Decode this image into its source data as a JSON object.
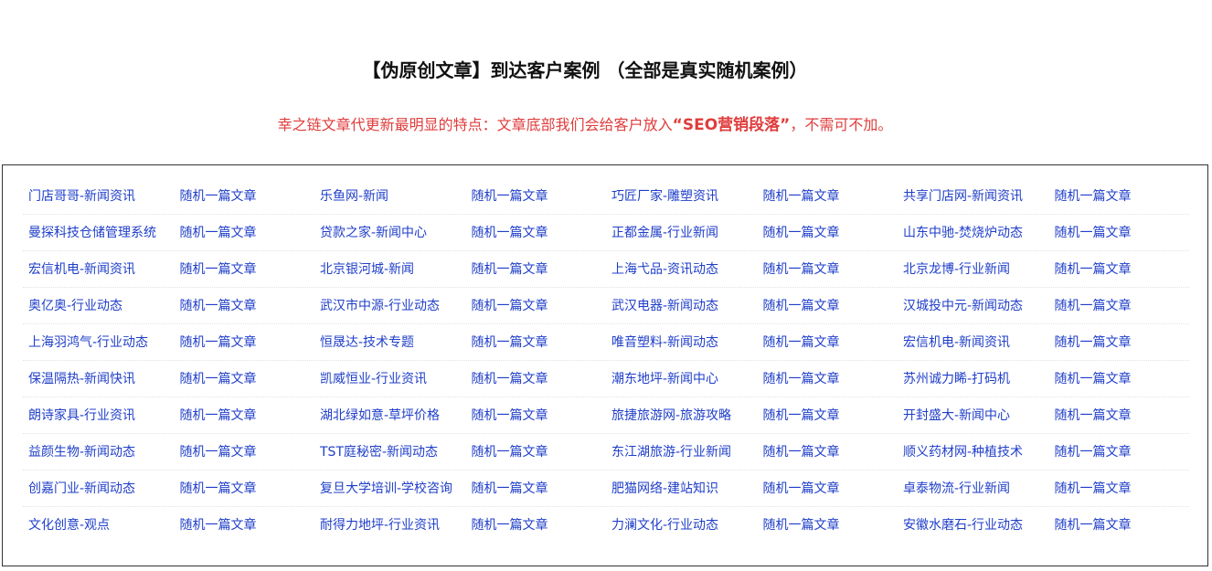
{
  "header": {
    "title": "【伪原创文章】到达客户案例 （全部是真实随机案例）",
    "subtitle_prefix": "幸之链文章代更新最明显的特点：文章底部我们会给客户放入",
    "subtitle_emphasis": "“SEO营销段落”",
    "subtitle_suffix": "，不需可不加。"
  },
  "colors": {
    "link": "#1f3ec9",
    "accent": "#e03c3c",
    "title": "#111111"
  },
  "random_label": "随机一篇文章",
  "rows": [
    [
      "门店哥哥-新闻资讯",
      "乐鱼网-新闻",
      "巧匠厂家-雕塑资讯",
      "共享门店网-新闻资讯"
    ],
    [
      "曼探科技仓储管理系统",
      "贷款之家-新闻中心",
      "正都金属-行业新闻",
      "山东中驰-焚烧炉动态"
    ],
    [
      "宏信机电-新闻资讯",
      "北京银河城-新闻",
      "上海弋品-资讯动态",
      "北京龙博-行业新闻"
    ],
    [
      "奥亿奥-行业动态",
      "武汉市中源-行业动态",
      "武汉电器-新闻动态",
      "汉城投中元-新闻动态"
    ],
    [
      "上海羽鸿气-行业动态",
      "恒晟达-技术专题",
      "唯音塑料-新闻动态",
      "宏信机电-新闻资讯"
    ],
    [
      "保温隔热-新闻快讯",
      "凯威恒业-行业资讯",
      "潮东地坪-新闻中心",
      "苏州诚力睎-打码机"
    ],
    [
      "朗诗家具-行业资讯",
      "湖北绿如意-草坪价格",
      "旅捷旅游网-旅游攻略",
      "开封盛大-新闻中心"
    ],
    [
      "益颜生物-新闻动态",
      "TST庭秘密-新闻动态",
      "东江湖旅游-行业新闻",
      "顺义药材网-种植技术"
    ],
    [
      "创嘉门业-新闻动态",
      "复旦大学培训-学校咨询",
      "肥猫网络-建站知识",
      "卓泰物流-行业新闻"
    ],
    [
      "文化创意-观点",
      "耐得力地坪-行业资讯",
      "力澜文化-行业动态",
      "安徽水磨石-行业动态"
    ]
  ]
}
